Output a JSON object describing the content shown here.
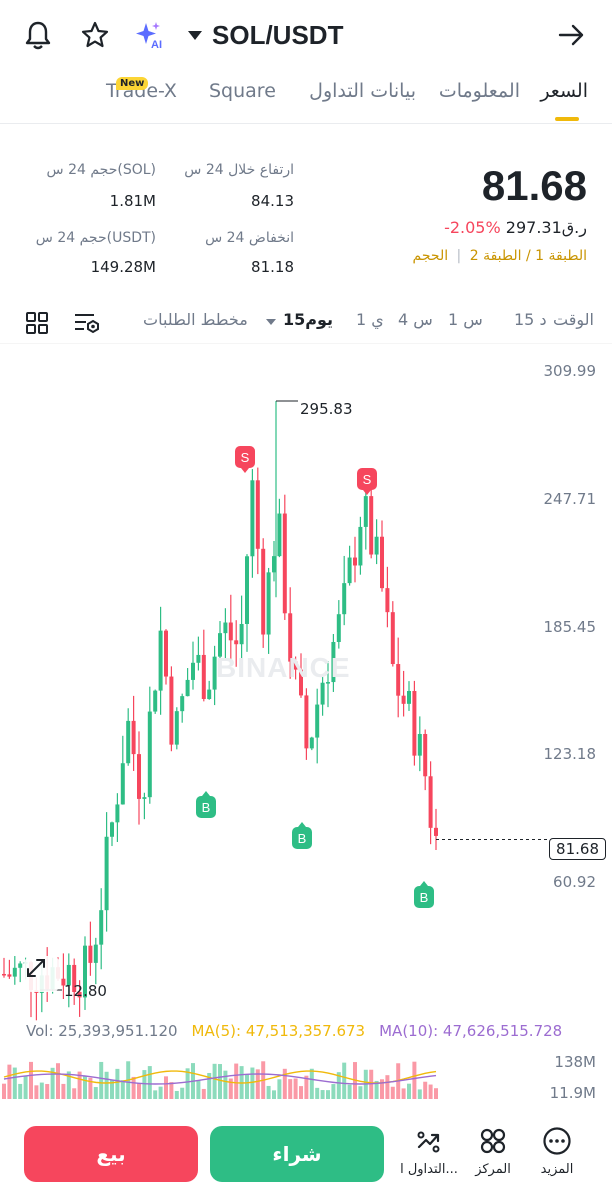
{
  "header": {
    "pair": "SOL/USDT",
    "ai_badge": "AI"
  },
  "tabs": [
    {
      "label": "السعر",
      "active": true
    },
    {
      "label": "المعلومات",
      "active": false
    },
    {
      "label": "بيانات التداول",
      "active": false
    },
    {
      "label": "Square",
      "active": false
    },
    {
      "label": "Trade-X",
      "active": false,
      "badge": "New"
    }
  ],
  "stats": {
    "last_price": "81.68",
    "change_pct": "-2.05%",
    "ref_price": "297.31",
    "ref_prefix": "ر.ق",
    "layer1": "الطبقة 1",
    "layer_sep": "/",
    "layer2": "الطبقة 2",
    "volume_tag": "الحجم",
    "high_label": "ارتفاع خلال 24 س",
    "high_value": "84.13",
    "low_label": "انخفاض 24 س",
    "low_value": "81.18",
    "vol_sol_label": "حجم 24 س(SOL)",
    "vol_sol_value": "1.81M",
    "vol_usdt_label": "حجم 24 س(USDT)",
    "vol_usdt_value": "149.28M"
  },
  "timeframes": {
    "time_label": "الوقت",
    "items": [
      "15 د",
      "1 س",
      "4 س",
      "1 ي"
    ],
    "active": "15يوم",
    "depth": "مخطط الطلبات"
  },
  "chart": {
    "price_axis": [
      "309.99",
      "247.71",
      "185.45",
      "123.18",
      "60.92"
    ],
    "current_price": "81.68",
    "max_label": "295.83",
    "min_label": "12.80",
    "watermark": "BINANCE",
    "sell_marker": "S",
    "buy_marker": "B",
    "colors": {
      "up": "#2ebd85",
      "down": "#f6465d",
      "ma5": "#f0b90b",
      "ma10": "#9c6cd1"
    }
  },
  "volume": {
    "vol_label": "Vol: 25,393,951.120",
    "ma5_label": "MA(5): 47,513,357.673",
    "ma10_label": "MA(10): 47,626,515.728",
    "axis_top": "138M",
    "axis_bottom": "11.9M"
  },
  "bottom_nav": {
    "more": "المزيد",
    "center": "المركز",
    "trade": "التداول ا...",
    "buy": "شراء",
    "sell": "بيع"
  }
}
